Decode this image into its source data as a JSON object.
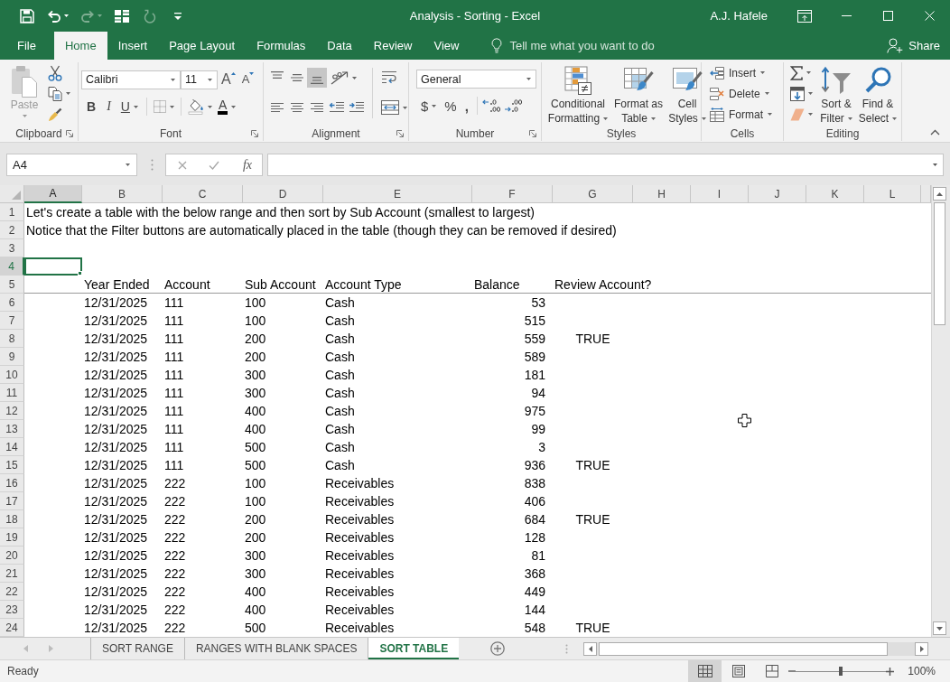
{
  "window": {
    "title": "Analysis - Sorting - Excel",
    "user": "A.J. Hafele"
  },
  "quick_access": [
    {
      "kind": "save",
      "disabled": false
    },
    {
      "kind": "undo",
      "disabled": false
    },
    {
      "kind": "redo",
      "disabled": true
    },
    {
      "kind": "form",
      "disabled": false
    },
    {
      "kind": "repeat",
      "disabled": true
    }
  ],
  "ribbon_tabs": [
    {
      "label": "File",
      "selected": false
    },
    {
      "label": "Home",
      "selected": true
    },
    {
      "label": "Insert",
      "selected": false
    },
    {
      "label": "Page Layout",
      "selected": false
    },
    {
      "label": "Formulas",
      "selected": false
    },
    {
      "label": "Data",
      "selected": false
    },
    {
      "label": "Review",
      "selected": false
    },
    {
      "label": "View",
      "selected": false
    }
  ],
  "tell_me": {
    "placeholder": "Tell me what you want to do"
  },
  "share": "Share",
  "ribbon": {
    "clipboard": {
      "label": "Clipboard",
      "paste": {
        "label": "Paste",
        "disabled": true
      }
    },
    "font": {
      "label": "Font",
      "font_name": "Calibri",
      "font_size": "11",
      "grow": "A",
      "shrink": "A",
      "bold": "B",
      "italic": "I",
      "underline": "U",
      "font_color": "A"
    },
    "alignment": {
      "label": "Alignment",
      "vertical_align": [
        {
          "kind": "top",
          "selected": false
        },
        {
          "kind": "middle",
          "selected": false
        },
        {
          "kind": "bottom",
          "selected": true
        }
      ]
    },
    "number": {
      "label": "Number",
      "format": "General",
      "currency": "$",
      "percent": "%",
      "comma": ","
    },
    "styles": {
      "label": "Styles",
      "buttons": [
        {
          "kind": "conditional",
          "label": "Conditional Formatting"
        },
        {
          "kind": "table",
          "label": "Format as Table"
        },
        {
          "kind": "cell_styles",
          "label": "Cell Styles"
        }
      ]
    },
    "cells": {
      "label": "Cells",
      "buttons": [
        {
          "kind": "insert",
          "label": "Insert"
        },
        {
          "kind": "delete",
          "label": "Delete"
        },
        {
          "kind": "format",
          "label": "Format"
        }
      ]
    },
    "editing": {
      "label": "Editing",
      "buttons": [
        {
          "kind": "sort_filter",
          "label": "Sort & Filter"
        },
        {
          "kind": "find_select",
          "label": "Find & Select"
        }
      ]
    }
  },
  "formula_bar": {
    "name_box": "A4",
    "function_label": "fx"
  },
  "sheet": {
    "columns": [
      {
        "label": "A",
        "selected": true
      },
      {
        "label": "B",
        "selected": false
      },
      {
        "label": "C",
        "selected": false
      },
      {
        "label": "D",
        "selected": false
      },
      {
        "label": "E",
        "selected": false
      },
      {
        "label": "F",
        "selected": false
      },
      {
        "label": "G",
        "selected": false
      },
      {
        "label": "H",
        "selected": false
      },
      {
        "label": "I",
        "selected": false
      },
      {
        "label": "J",
        "selected": false
      },
      {
        "label": "K",
        "selected": false
      },
      {
        "label": "L",
        "selected": false
      }
    ],
    "rows": [
      {
        "number": "1",
        "selected": false,
        "kind": "note",
        "text": "Let's create a table with the below range and then sort by Sub Account (smallest to largest)"
      },
      {
        "number": "2",
        "selected": false,
        "kind": "note",
        "text": "Notice that the Filter buttons are automatically placed in the table (though they can be removed if desired)"
      },
      {
        "number": "3",
        "selected": false,
        "kind": "blank"
      },
      {
        "number": "4",
        "selected": true,
        "kind": "blank"
      },
      {
        "number": "5",
        "selected": false,
        "kind": "header",
        "cells": [
          "Year Ended",
          "Account",
          "Sub Account",
          "Account Type",
          "Balance",
          "Review Account?"
        ]
      },
      {
        "number": "6",
        "selected": false,
        "kind": "record",
        "year_ended": "12/31/2025",
        "account": "111",
        "sub_account": "100",
        "account_type": "Cash",
        "balance": "53"
      },
      {
        "number": "7",
        "selected": false,
        "kind": "record",
        "year_ended": "12/31/2025",
        "account": "111",
        "sub_account": "100",
        "account_type": "Cash",
        "balance": "515"
      },
      {
        "number": "8",
        "selected": false,
        "kind": "record",
        "year_ended": "12/31/2025",
        "account": "111",
        "sub_account": "200",
        "account_type": "Cash",
        "balance": "559",
        "review_account": "TRUE"
      },
      {
        "number": "9",
        "selected": false,
        "kind": "record",
        "year_ended": "12/31/2025",
        "account": "111",
        "sub_account": "200",
        "account_type": "Cash",
        "balance": "589"
      },
      {
        "number": "10",
        "selected": false,
        "kind": "record",
        "year_ended": "12/31/2025",
        "account": "111",
        "sub_account": "300",
        "account_type": "Cash",
        "balance": "181"
      },
      {
        "number": "11",
        "selected": false,
        "kind": "record",
        "year_ended": "12/31/2025",
        "account": "111",
        "sub_account": "300",
        "account_type": "Cash",
        "balance": "94"
      },
      {
        "number": "12",
        "selected": false,
        "kind": "record",
        "year_ended": "12/31/2025",
        "account": "111",
        "sub_account": "400",
        "account_type": "Cash",
        "balance": "975"
      },
      {
        "number": "13",
        "selected": false,
        "kind": "record",
        "year_ended": "12/31/2025",
        "account": "111",
        "sub_account": "400",
        "account_type": "Cash",
        "balance": "99"
      },
      {
        "number": "14",
        "selected": false,
        "kind": "record",
        "year_ended": "12/31/2025",
        "account": "111",
        "sub_account": "500",
        "account_type": "Cash",
        "balance": "3"
      },
      {
        "number": "15",
        "selected": false,
        "kind": "record",
        "year_ended": "12/31/2025",
        "account": "111",
        "sub_account": "500",
        "account_type": "Cash",
        "balance": "936",
        "review_account": "TRUE"
      },
      {
        "number": "16",
        "selected": false,
        "kind": "record",
        "year_ended": "12/31/2025",
        "account": "222",
        "sub_account": "100",
        "account_type": "Receivables",
        "balance": "838"
      },
      {
        "number": "17",
        "selected": false,
        "kind": "record",
        "year_ended": "12/31/2025",
        "account": "222",
        "sub_account": "100",
        "account_type": "Receivables",
        "balance": "406"
      },
      {
        "number": "18",
        "selected": false,
        "kind": "record",
        "year_ended": "12/31/2025",
        "account": "222",
        "sub_account": "200",
        "account_type": "Receivables",
        "balance": "684",
        "review_account": "TRUE"
      },
      {
        "number": "19",
        "selected": false,
        "kind": "record",
        "year_ended": "12/31/2025",
        "account": "222",
        "sub_account": "200",
        "account_type": "Receivables",
        "balance": "128"
      },
      {
        "number": "20",
        "selected": false,
        "kind": "record",
        "year_ended": "12/31/2025",
        "account": "222",
        "sub_account": "300",
        "account_type": "Receivables",
        "balance": "81"
      },
      {
        "number": "21",
        "selected": false,
        "kind": "record",
        "year_ended": "12/31/2025",
        "account": "222",
        "sub_account": "300",
        "account_type": "Receivables",
        "balance": "368"
      },
      {
        "number": "22",
        "selected": false,
        "kind": "record",
        "year_ended": "12/31/2025",
        "account": "222",
        "sub_account": "400",
        "account_type": "Receivables",
        "balance": "449"
      },
      {
        "number": "23",
        "selected": false,
        "kind": "record",
        "year_ended": "12/31/2025",
        "account": "222",
        "sub_account": "400",
        "account_type": "Receivables",
        "balance": "144"
      },
      {
        "number": "24",
        "selected": false,
        "kind": "record",
        "year_ended": "12/31/2025",
        "account": "222",
        "sub_account": "500",
        "account_type": "Receivables",
        "balance": "548",
        "review_account": "TRUE"
      }
    ]
  },
  "sheet_tabs": [
    {
      "label": "SORT RANGE",
      "selected": false
    },
    {
      "label": "RANGES WITH BLANK SPACES",
      "selected": false
    },
    {
      "label": "SORT TABLE",
      "selected": true
    }
  ],
  "status_bar": {
    "text": "Ready",
    "views": [
      {
        "kind": "normal",
        "selected": true
      },
      {
        "kind": "page_layout",
        "selected": false
      },
      {
        "kind": "page_break",
        "selected": false
      }
    ],
    "zoom": {
      "level": 0.5,
      "label": "100%"
    }
  }
}
